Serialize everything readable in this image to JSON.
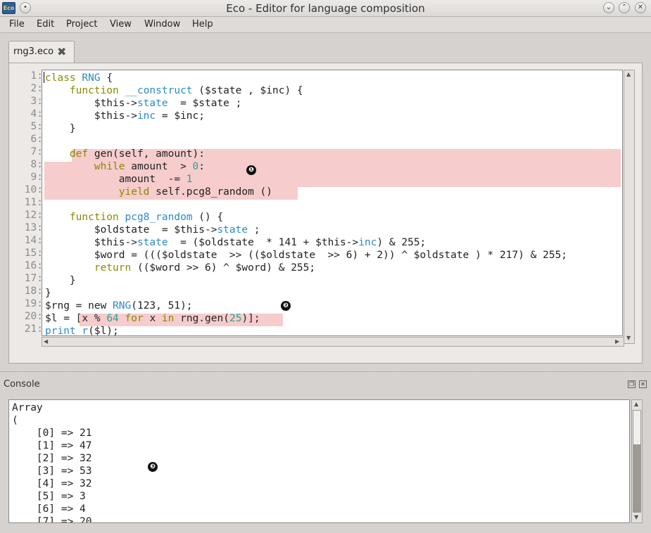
{
  "window": {
    "title": "Eco - Editor for language composition",
    "icon_label": "Eco"
  },
  "menu": [
    "File",
    "Edit",
    "Project",
    "View",
    "Window",
    "Help"
  ],
  "tab": {
    "label": "rng3.eco"
  },
  "line_numbers": [
    "1:",
    "2:",
    "3:",
    "4:",
    "5:",
    "6:",
    "7:",
    "8:",
    "9:",
    "10:",
    "11:",
    "12:",
    "13:",
    "14:",
    "15:",
    "16:",
    "17:",
    "18:",
    "19:",
    "20:",
    "21:"
  ],
  "code_lines": [
    [
      [
        "class",
        "kw"
      ],
      [
        " "
      ],
      [
        "RNG",
        "fn"
      ],
      [
        " {"
      ]
    ],
    [
      [
        "    "
      ],
      [
        "function",
        "kw"
      ],
      [
        " "
      ],
      [
        "__construct",
        "fn"
      ],
      [
        " ($state , $inc) {"
      ]
    ],
    [
      [
        "        $this->"
      ],
      [
        "state",
        "fn"
      ],
      [
        "  = $state ;"
      ]
    ],
    [
      [
        "        $this->"
      ],
      [
        "inc",
        "fn"
      ],
      [
        " = $inc;"
      ]
    ],
    [
      [
        "    }"
      ]
    ],
    [
      [
        ""
      ]
    ],
    [
      [
        "    "
      ],
      [
        "def",
        "kw"
      ],
      [
        " gen(self, amount):"
      ]
    ],
    [
      [
        "        "
      ],
      [
        "while",
        "kw"
      ],
      [
        " amount  > "
      ],
      [
        "0",
        "num"
      ],
      [
        ":"
      ]
    ],
    [
      [
        "            amount  -= "
      ],
      [
        "1",
        "num"
      ]
    ],
    [
      [
        "            "
      ],
      [
        "yield",
        "kw"
      ],
      [
        " self.pcg8_random ()"
      ]
    ],
    [
      [
        ""
      ]
    ],
    [
      [
        "    "
      ],
      [
        "function",
        "kw"
      ],
      [
        " "
      ],
      [
        "pcg8_random",
        "fn"
      ],
      [
        " () {"
      ]
    ],
    [
      [
        "        $oldstate  = $this->"
      ],
      [
        "state",
        "fn"
      ],
      [
        " ;"
      ]
    ],
    [
      [
        "        $this->"
      ],
      [
        "state",
        "fn"
      ],
      [
        "  = ($oldstate  * 141 + $this->"
      ],
      [
        "inc",
        "fn"
      ],
      [
        ") & 255;"
      ]
    ],
    [
      [
        "        $word = ((($oldstate  >> (($oldstate  >> 6) + 2)) ^ $oldstate ) * 217) & 255;"
      ]
    ],
    [
      [
        "        "
      ],
      [
        "return",
        "kw"
      ],
      [
        " (($word >> 6) ^ $word) & 255;"
      ]
    ],
    [
      [
        "    }"
      ]
    ],
    [
      [
        "}"
      ]
    ],
    [
      [
        "$rng = new "
      ],
      [
        "RNG",
        "fn"
      ],
      [
        "(123, 51);"
      ]
    ],
    [
      [
        "$l = [x % "
      ],
      [
        "64",
        "num"
      ],
      [
        " "
      ],
      [
        "for",
        "kw"
      ],
      [
        " x "
      ],
      [
        "in",
        "kw"
      ],
      [
        " rng.gen("
      ],
      [
        "25",
        "num"
      ],
      [
        ")];"
      ]
    ],
    [
      [
        "print_r",
        "fn"
      ],
      [
        "($l);"
      ]
    ]
  ],
  "markers": [
    "❶",
    "❷",
    "❸"
  ],
  "console": {
    "title": "Console",
    "lines": [
      "Array",
      "(",
      "    [0] => 21",
      "    [1] => 47",
      "    [2] => 32",
      "    [3] => 53",
      "    [4] => 32",
      "    [5] => 3",
      "    [6] => 4",
      "    [7] => 20"
    ]
  }
}
